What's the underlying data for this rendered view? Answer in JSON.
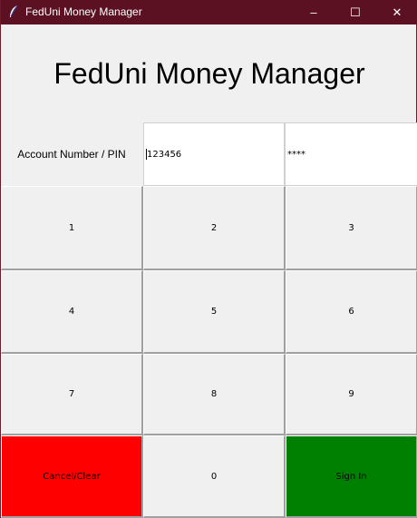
{
  "window": {
    "title": "FedUni Money Manager",
    "controls": {
      "minimize": "–",
      "maximize": "☐",
      "close": "✕"
    },
    "icon": "feather-icon",
    "titlebar_color": "#5c1122"
  },
  "app": {
    "heading": "FedUni Money Manager",
    "account_label": "Account Number / PIN",
    "account_number_value": "123456",
    "pin_value": "****"
  },
  "keypad": {
    "keys": [
      "1",
      "2",
      "3",
      "4",
      "5",
      "6",
      "7",
      "8",
      "9"
    ],
    "cancel_label": "Cancel/Clear",
    "zero_label": "0",
    "sign_in_label": "Sign In",
    "cancel_color": "#ff0000",
    "sign_in_color": "#008000"
  }
}
